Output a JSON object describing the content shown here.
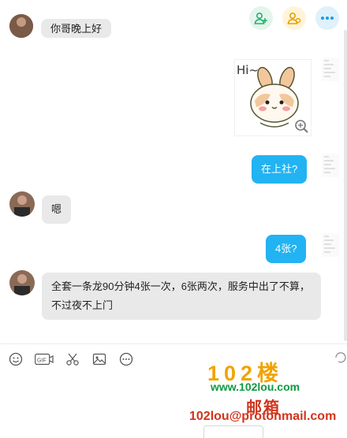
{
  "colors": {
    "accent": "#22b3f2",
    "bubble_left": "#e9e9e9",
    "watermark_orange": "#f2a300",
    "watermark_green": "#0e9a3f",
    "watermark_red": "#d0341d"
  },
  "header": {
    "icons": [
      "add-contact-icon",
      "group-add-icon",
      "more-icon"
    ]
  },
  "messages": [
    {
      "side": "left",
      "text": "你哥晚上好"
    },
    {
      "side": "right",
      "type": "sticker",
      "sticker_text": "Hi~"
    },
    {
      "side": "right",
      "text": "在上社?"
    },
    {
      "side": "left",
      "text": "嗯"
    },
    {
      "side": "right",
      "text": "4张?"
    },
    {
      "side": "left",
      "text": "全套一条龙90分钟4张一次，6张两次，服务中出了不算，不过夜不上门"
    }
  ],
  "toolbar": {
    "icons": [
      "emoji-icon",
      "gif-icon",
      "scissors-icon",
      "image-icon",
      "more-circle-icon"
    ],
    "gif_label": "GIF"
  },
  "watermark": {
    "title": "102楼",
    "site": "www.102lou.com",
    "mail_label": "邮箱",
    "email": "102lou@protonmail.com"
  }
}
